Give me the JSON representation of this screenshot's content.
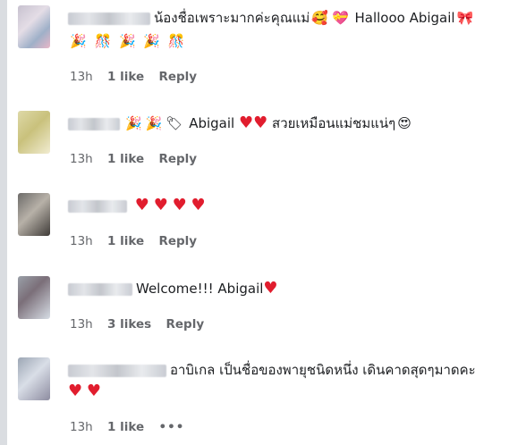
{
  "comments": [
    {
      "text": "น้องชื่อเพราะมากค่ะคุณแม่",
      "text2": "Hallooo Abigail",
      "emojis_line2": [
        "🎉",
        "🎊",
        "🎉",
        "🎉",
        "🎊"
      ],
      "time": "13h",
      "likes": "1 like",
      "reply": "Reply"
    },
    {
      "text": "Abigail",
      "text2": "สวยเหมือนแม่ชมแน่ๆ",
      "time": "13h",
      "likes": "1 like",
      "reply": "Reply"
    },
    {
      "text": "",
      "time": "13h",
      "likes": "1 like",
      "reply": "Reply"
    },
    {
      "text": "Welcome!!! Abigail",
      "time": "13h",
      "likes": "3 likes",
      "reply": "Reply"
    },
    {
      "text": "อาบิเกล เป็นชื่อของพายุชนิดหนึ่ง เดินคาดสุดๆมาดคะ",
      "time": "13h",
      "likes": "1 like",
      "more": "•••"
    }
  ],
  "colors": {
    "heart": "#e11d2e",
    "meta": "#65676b",
    "rule": "#dadde1"
  }
}
